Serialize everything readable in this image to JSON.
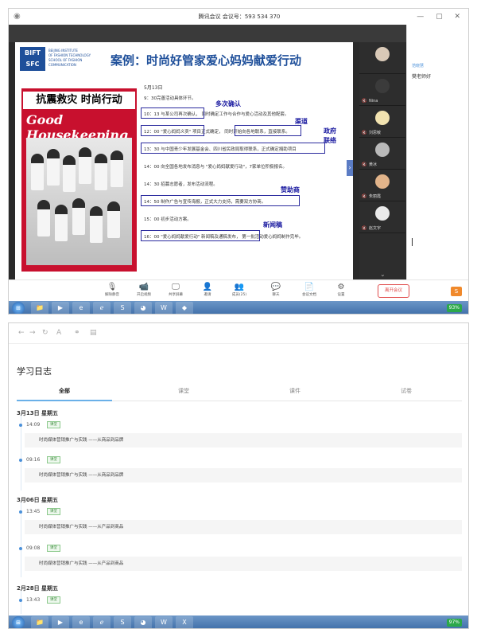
{
  "meeting": {
    "title": "腾讯会议 会议号：593 534 370",
    "slide": {
      "logo_line1": "BIFT",
      "logo_line2": "SFC",
      "school_line1": "BEIJING INSTITUTE",
      "school_line2": "OF FASHION TECHNOLOGY",
      "school_line3": "SCHOOL OF FASHION COMMUNICATION",
      "title": "案例：时尚好管家爱心妈妈献爱行动",
      "date": "5月13日",
      "magazine_headline": "抗震救灾 时尚行动",
      "magazine_name": "Good Housekeeping",
      "lines": [
        "9：30完善活动具体环节。",
        "10：13 与某公司再次确认，   同时确定工作与合作与爱心活动及其他配套。",
        "12：00 \"爱心妈妈义卖\" 项目正式确定，   同时开始向各地联系，直接联系。",
        "13：30 与中国青少年发展基金会、四川省民政局取得联系，正式确定捐助项目",
        "14：00 向全国各地发布消息与 \"爱心妈妈献爱行动\"，7家单位积极报名。",
        "14：30 招募志愿者，发布活动流程。",
        "14：50 制作广告与宣传海报，正式大力支持，需要双方协商。",
        "15：00 初步活动方案。",
        "16：00 \"爱心妈妈献爱行动\" 新闻稿及通稿发布，   第一批活动爱心妈妈制作完毕。"
      ],
      "annotations": [
        "多次确认",
        "渠道",
        "政府",
        "联络",
        "赞助商",
        "新闻稿"
      ]
    },
    "participants": [
      {
        "name": ""
      },
      {
        "name": "Nina"
      },
      {
        "name": "刘思敏"
      },
      {
        "name": "黄冰"
      },
      {
        "name": "朱丽霞"
      },
      {
        "name": "赵文宇"
      }
    ],
    "chat": {
      "sender": "范晓慧",
      "message": "樊老师好"
    },
    "toolbar": [
      {
        "label": "解除静音",
        "icon": "mic-off-icon"
      },
      {
        "label": "开启视频",
        "icon": "video-off-icon"
      },
      {
        "label": "共享屏幕",
        "icon": "screen-share-icon"
      },
      {
        "label": "邀请",
        "icon": "invite-icon"
      },
      {
        "label": "成员(25)",
        "icon": "members-icon"
      },
      {
        "label": "聊天",
        "icon": "chat-icon"
      },
      {
        "label": "会议文档",
        "icon": "document-icon"
      },
      {
        "label": "设置",
        "icon": "gear-icon"
      }
    ],
    "end_button": "离开会议",
    "tray_battery": "93%"
  },
  "log": {
    "title": "学习日志",
    "tabs": [
      "全部",
      "课堂",
      "课件",
      "试卷"
    ],
    "days": [
      {
        "date": "3月13日   星期五",
        "entries": [
          {
            "time": "14:09",
            "badge": "课堂",
            "text": "时尚媒体营销推广与实践 ——从商品到品牌"
          },
          {
            "time": "09:16",
            "badge": "课堂",
            "text": "时尚媒体营销推广与实践 ——从商品到品牌"
          }
        ]
      },
      {
        "date": "3月06日   星期五",
        "entries": [
          {
            "time": "13:45",
            "badge": "课堂",
            "text": "时尚媒体营销推广与实践 ——从产品到商品"
          },
          {
            "time": "09:08",
            "badge": "课堂",
            "text": "时尚媒体营销推广与实践 ——从产品到商品"
          }
        ]
      },
      {
        "date": "2月28日   星期五",
        "entries": [
          {
            "time": "13:43",
            "badge": "课堂",
            "text": ""
          }
        ]
      }
    ],
    "tray_battery": "97%"
  }
}
